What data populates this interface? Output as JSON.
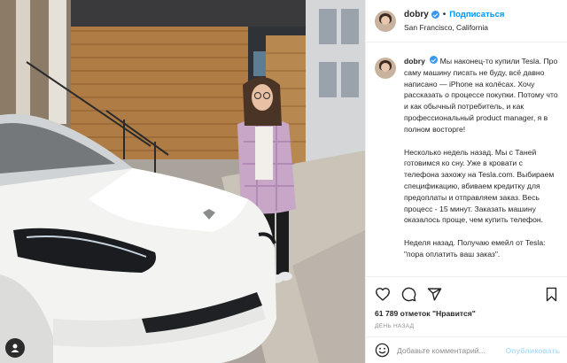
{
  "post": {
    "author": {
      "username": "dobry",
      "verified": true,
      "follow_label": "Подписаться",
      "separator": "•",
      "location": "San Francisco, California"
    },
    "caption": {
      "username": "dobry",
      "paragraphs": [
        "Мы наконец-то купили Tesla. Про саму машину писать не буду, всё давно написано — iPhone на колёсах. Хочу рассказать о процессе покупки. Потому что и как обычный потребитель, и как профессиональный product manager, я в полном восторге!",
        "Несколько недель назад. Мы с Таней готовимся ко сну. Уже в кровати с телефона захожу на Tesla.com. Выбираем спецификацию, вбиваем кредитку для предоплаты и отправляем заказ. Весь процесс - 15 минут. Заказать машину оказалось проще, чем купить телефон.",
        "Неделя назад. Получаю емейл от Tesla: \"пора оплатить ваш заказ\"."
      ]
    },
    "actions": {
      "like_icon": "heart-outline-icon",
      "comment_icon": "comment-bubble-icon",
      "share_icon": "paper-plane-icon",
      "save_icon": "bookmark-icon"
    },
    "likes_text": "61 789 отметок \"Нравится\"",
    "timestamp": "ДЕНЬ НАЗАД",
    "comment": {
      "placeholder": "Добавьте комментарий...",
      "publish_label": "Опубликовать"
    }
  },
  "photo": {
    "description_icon": "user-tag-icon",
    "colors": {
      "car": "#f2f2f0",
      "house_wood": "#b58650",
      "sidewalk": "#c7c2ba",
      "sky": "#dfe6ec"
    }
  },
  "colors": {
    "accent": "#0095f6",
    "text": "#262626",
    "muted": "#8e8e8e",
    "border": "#efefef"
  }
}
